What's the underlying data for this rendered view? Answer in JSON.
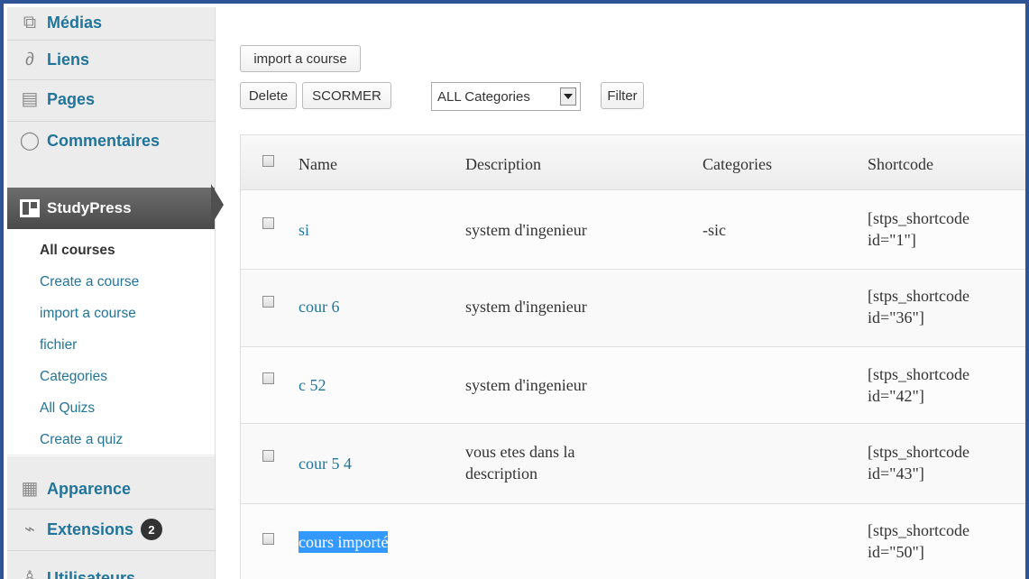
{
  "sidebar": {
    "menu_top": [
      {
        "label": "Médias",
        "icon": "media-icon"
      },
      {
        "label": "Liens",
        "icon": "links-icon"
      },
      {
        "label": "Pages",
        "icon": "pages-icon"
      },
      {
        "label": "Commentaires",
        "icon": "comments-icon"
      }
    ],
    "active_menu": {
      "label": "StudyPress",
      "icon": "studypress-icon"
    },
    "submenu": [
      {
        "label": "All courses",
        "current": true
      },
      {
        "label": "Create a course"
      },
      {
        "label": "import a course"
      },
      {
        "label": "fichier"
      },
      {
        "label": "Categories"
      },
      {
        "label": "All Quizs"
      },
      {
        "label": "Create a quiz"
      }
    ],
    "menu_bottom": [
      {
        "label": "Apparence",
        "icon": "appearance-icon"
      },
      {
        "label": "Extensions",
        "icon": "plugins-icon",
        "badge": "2"
      },
      {
        "label": "Utilisateurs",
        "icon": "users-icon"
      }
    ]
  },
  "toolbar": {
    "import_label": "import a course",
    "delete_label": "Delete",
    "scormer_label": "SCORMER",
    "category_select": "ALL Categories",
    "filter_label": "Filter"
  },
  "table": {
    "headers": {
      "name": "Name",
      "description": "Description",
      "categories": "Categories",
      "shortcode": "Shortcode"
    },
    "rows": [
      {
        "name": "si",
        "description": "system d'ingenieur",
        "categories": "-sic",
        "shortcode_1": "[stps_shortcode",
        "shortcode_2": "id=\"1\"]"
      },
      {
        "name": "cour 6",
        "description": "system d'ingenieur",
        "categories": "",
        "shortcode_1": "[stps_shortcode",
        "shortcode_2": "id=\"36\"]"
      },
      {
        "name": "c 52",
        "description": "system d'ingenieur",
        "categories": "",
        "shortcode_1": "[stps_shortcode",
        "shortcode_2": "id=\"42\"]"
      },
      {
        "name": "cour 5 4",
        "description_1": "vous etes dans la",
        "description_2": "description",
        "categories": "",
        "shortcode_1": "[stps_shortcode",
        "shortcode_2": "id=\"43\"]"
      },
      {
        "name": "cours importé",
        "description": "",
        "categories": "",
        "shortcode_1": "[stps_shortcode",
        "shortcode_2": "id=\"50\"]",
        "selected": true
      }
    ]
  },
  "colors": {
    "link": "#21759b",
    "active_menu_bg": "#4a4a4a",
    "frame_border": "#2f5496",
    "selection": "#3399ff"
  }
}
